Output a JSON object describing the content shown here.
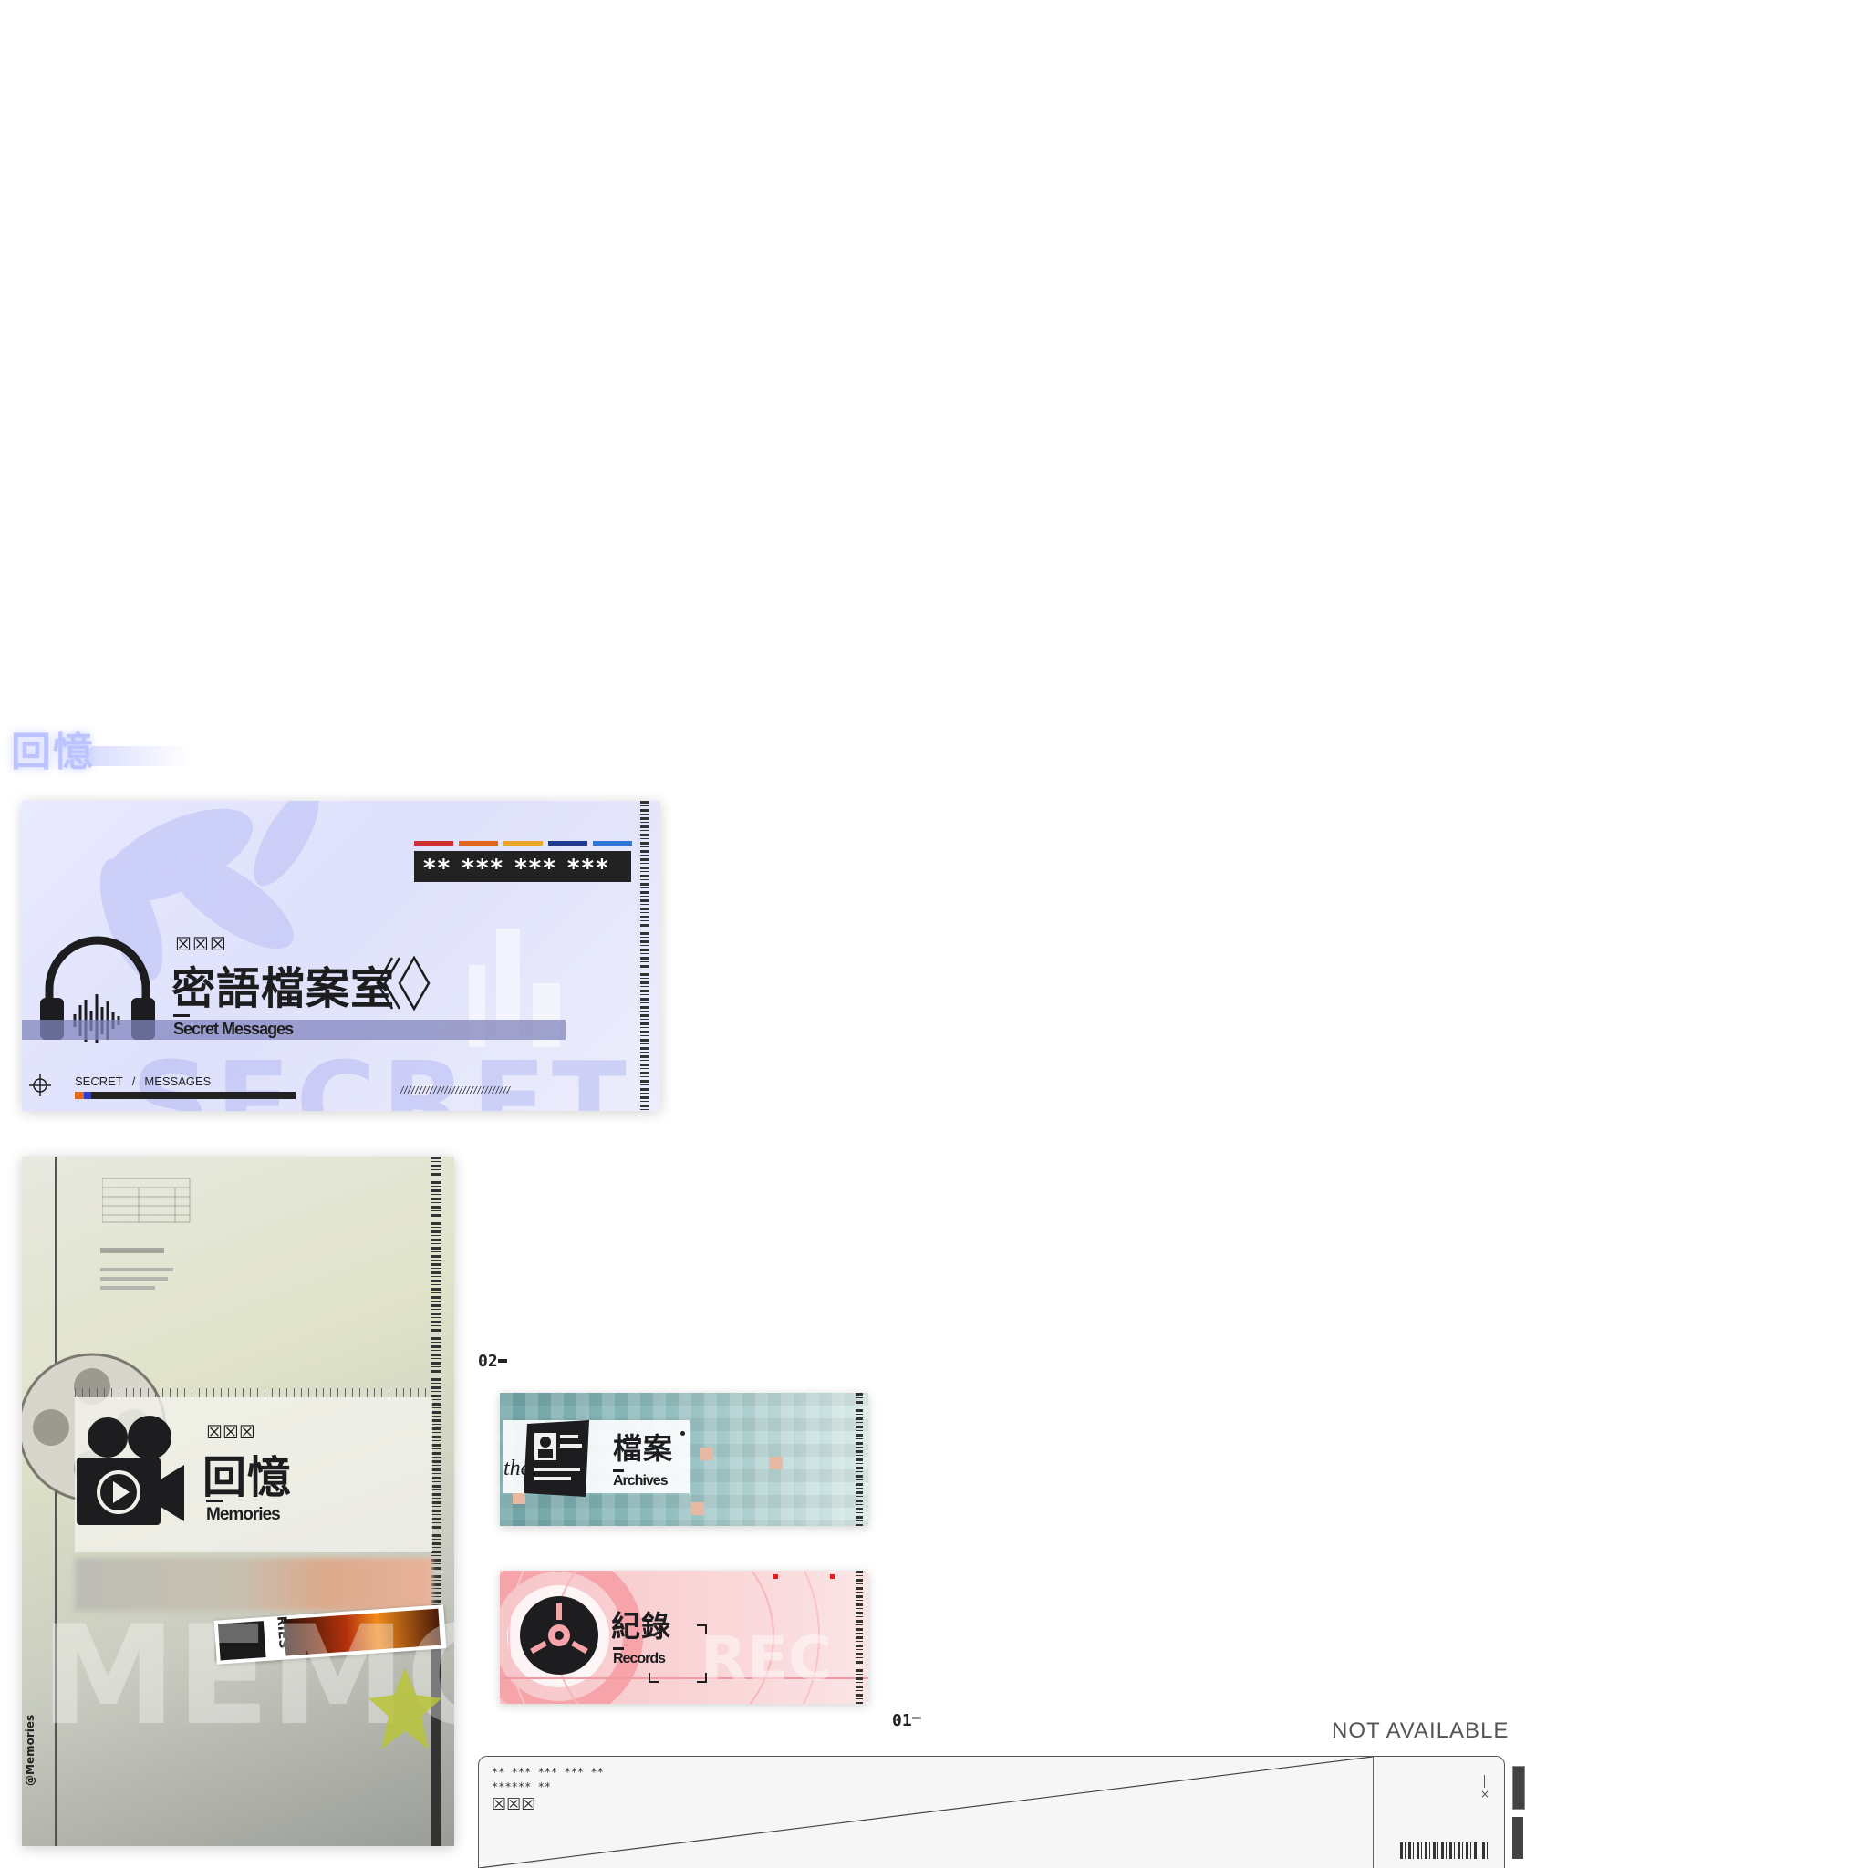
{
  "ghost_header": {
    "title": "回憶"
  },
  "secret_card": {
    "masked_code": "** *** *** ***",
    "tag_placeholder": "☒☒☒",
    "title_cn": "密語檔案室",
    "title_en": "Secret Messages",
    "breadcrumb": {
      "first": "SECRET",
      "separator": "/",
      "second": "MESSAGES"
    },
    "slash_pattern": "//////////////////////////////",
    "color_strip": [
      "#cc2f2f",
      "#e2671a",
      "#e8a52a",
      "#1f3a8f",
      "#2f78d8"
    ],
    "watermark": "SECRET"
  },
  "memories_card": {
    "tag_placeholder": "☒☒☒",
    "title_cn": "回憶",
    "title_en": "Memories",
    "side_text": "@Memories",
    "sticker_text": "RIES",
    "watermark": "MEMO"
  },
  "section_02": {
    "label": "02"
  },
  "archives_card": {
    "title_cn": "檔案",
    "title_en": "Archives",
    "scribble": "the"
  },
  "records_card": {
    "title_cn": "紀錄",
    "title_en": "Records",
    "watermark": "REC"
  },
  "section_01": {
    "label": "01"
  },
  "status_label": "NOT AVAILABLE",
  "bottom_panel": {
    "line1": "** *** *** *** **",
    "line2": "****** **",
    "tag_placeholder": "☒☒☒",
    "close_glyph": "×"
  }
}
